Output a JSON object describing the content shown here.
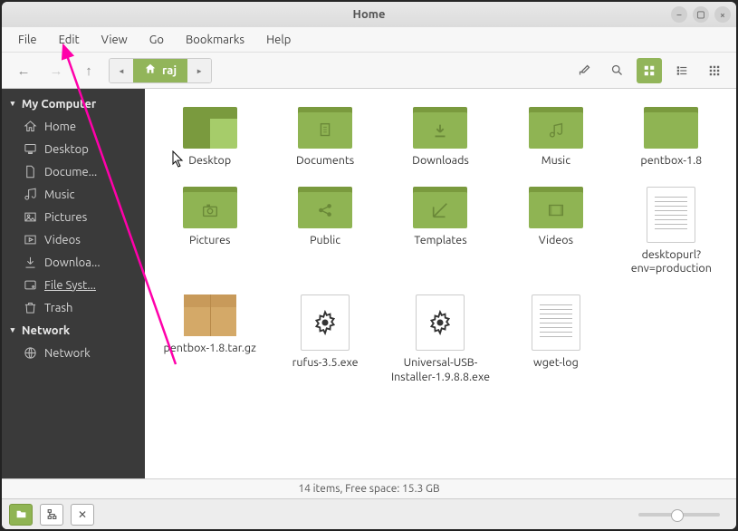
{
  "window": {
    "title": "Home"
  },
  "menu": [
    "File",
    "Edit",
    "View",
    "Go",
    "Bookmarks",
    "Help"
  ],
  "path": {
    "location": "raj"
  },
  "sidebar": {
    "sections": [
      {
        "label": "My Computer",
        "items": [
          {
            "label": "Home",
            "icon": "home"
          },
          {
            "label": "Desktop",
            "icon": "desktop"
          },
          {
            "label": "Docume...",
            "icon": "document"
          },
          {
            "label": "Music",
            "icon": "music"
          },
          {
            "label": "Pictures",
            "icon": "pictures"
          },
          {
            "label": "Videos",
            "icon": "videos"
          },
          {
            "label": "Downloa...",
            "icon": "download"
          },
          {
            "label": "File Syst...",
            "icon": "disk",
            "selected": true
          },
          {
            "label": "Trash",
            "icon": "trash"
          }
        ]
      },
      {
        "label": "Network",
        "items": [
          {
            "label": "Network",
            "icon": "network"
          }
        ]
      }
    ]
  },
  "files": [
    {
      "label": "Desktop",
      "type": "folder-desktop"
    },
    {
      "label": "Documents",
      "type": "folder",
      "glyph": "doc"
    },
    {
      "label": "Downloads",
      "type": "folder",
      "glyph": "down"
    },
    {
      "label": "Music",
      "type": "folder",
      "glyph": "music"
    },
    {
      "label": "pentbox-1.8",
      "type": "folder"
    },
    {
      "label": "Pictures",
      "type": "folder",
      "glyph": "camera"
    },
    {
      "label": "Public",
      "type": "folder",
      "glyph": "share"
    },
    {
      "label": "Templates",
      "type": "folder",
      "glyph": "template"
    },
    {
      "label": "Videos",
      "type": "folder",
      "glyph": "video"
    },
    {
      "label": "desktopurl?env=production",
      "type": "text"
    },
    {
      "label": "pentbox-1.8.tar.gz",
      "type": "package"
    },
    {
      "label": "rufus-3.5.exe",
      "type": "exe"
    },
    {
      "label": "Universal-USB-Installer-1.9.8.8.exe",
      "type": "exe"
    },
    {
      "label": "wget-log",
      "type": "text"
    }
  ],
  "status": "14 items, Free space: 15.3 GB"
}
